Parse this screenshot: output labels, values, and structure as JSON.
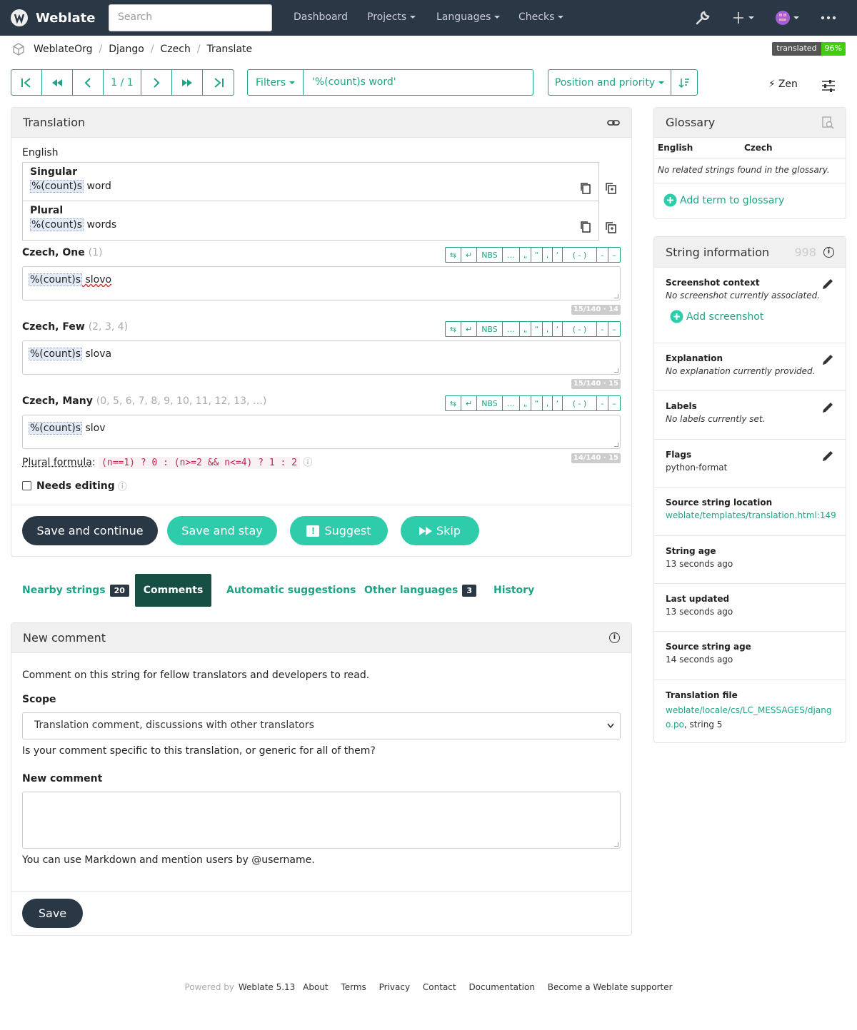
{
  "nav": {
    "brand": "Weblate",
    "search_placeholder": "Search",
    "items": [
      "Dashboard",
      "Projects",
      "Languages",
      "Checks"
    ]
  },
  "breadcrumb": [
    "WeblateOrg",
    "Django",
    "Czech",
    "Translate"
  ],
  "status_badge": {
    "label": "translated",
    "value": "96%"
  },
  "pager": {
    "position": "1 / 1"
  },
  "filter": {
    "button": "Filters",
    "query": "'%(count)s word'"
  },
  "sort": {
    "label": "Position and priority"
  },
  "zen": "Zen",
  "translation": {
    "title": "Translation",
    "source_lang": "English",
    "singular_label": "Singular",
    "singular_ph": "%(count)s",
    "singular_rest": " word",
    "plural_label": "Plural",
    "plural_ph": "%(count)s",
    "plural_rest": " words",
    "toolbar": [
      "⇆",
      "↵",
      "NBS",
      "…",
      "„",
      "“",
      ",",
      "‘",
      "( - )",
      "-",
      "–"
    ],
    "forms": [
      {
        "name": "Czech, One",
        "hint": "(1)",
        "ph": "%(count)s",
        "text": " slovo",
        "counter": "15/140 · 14"
      },
      {
        "name": "Czech, Few",
        "hint": "(2, 3, 4)",
        "ph": "%(count)s",
        "text": " slova",
        "counter": "15/140 · 15"
      },
      {
        "name": "Czech, Many",
        "hint": "(0, 5, 6, 7, 8, 9, 10, 11, 12, 13, …)",
        "ph": "%(count)s",
        "text": " slov",
        "counter": "14/140 · 15"
      }
    ],
    "plural_formula_label": "Plural formula",
    "plural_formula": "(n==1) ? 0 : (n>=2 && n<=4) ? 1 : 2",
    "needs_editing": "Needs editing",
    "buttons": {
      "save_continue": "Save and continue",
      "save_stay": "Save and stay",
      "suggest": "Suggest",
      "skip": "Skip"
    }
  },
  "tabs": [
    {
      "label": "Nearby strings",
      "count": "20"
    },
    {
      "label": "Comments"
    },
    {
      "label": "Automatic suggestions"
    },
    {
      "label": "Other languages",
      "count": "3"
    },
    {
      "label": "History"
    }
  ],
  "comment": {
    "title": "New comment",
    "intro": "Comment on this string for fellow translators and developers to read.",
    "scope_label": "Scope",
    "scope_value": "Translation comment, discussions with other translators",
    "scope_help": "Is your comment specific to this translation, or generic for all of them?",
    "field_label": "New comment",
    "field_help": "You can use Markdown and mention users by @username.",
    "save": "Save"
  },
  "glossary": {
    "title": "Glossary",
    "col_en": "English",
    "col_cs": "Czech",
    "empty": "No related strings found in the glossary.",
    "add": "Add term to glossary"
  },
  "string_info": {
    "title": "String information",
    "id": "998",
    "screenshot_title": "Screenshot context",
    "screenshot_value": "No screenshot currently associated.",
    "add_screenshot": "Add screenshot",
    "explanation_title": "Explanation",
    "explanation_value": "No explanation currently provided.",
    "labels_title": "Labels",
    "labels_value": "No labels currently set.",
    "flags_title": "Flags",
    "flags_value": "python-format",
    "location_title": "Source string location",
    "location_value": "weblate/templates/translation.html:149",
    "age_title": "String age",
    "age_value": "13 seconds ago",
    "updated_title": "Last updated",
    "updated_value": "13 seconds ago",
    "src_age_title": "Source string age",
    "src_age_value": "14 seconds ago",
    "file_title": "Translation file",
    "file_link_1": "weblate/locale/cs/LC_MESSAGES/djang",
    "file_link_2": "o.po",
    "file_suffix": ", string 5"
  },
  "footer": {
    "powered_by": "Powered by",
    "version": "Weblate 5.13",
    "links": [
      "About",
      "Terms",
      "Privacy",
      "Contact",
      "Documentation",
      "Become a Weblate supporter"
    ]
  }
}
